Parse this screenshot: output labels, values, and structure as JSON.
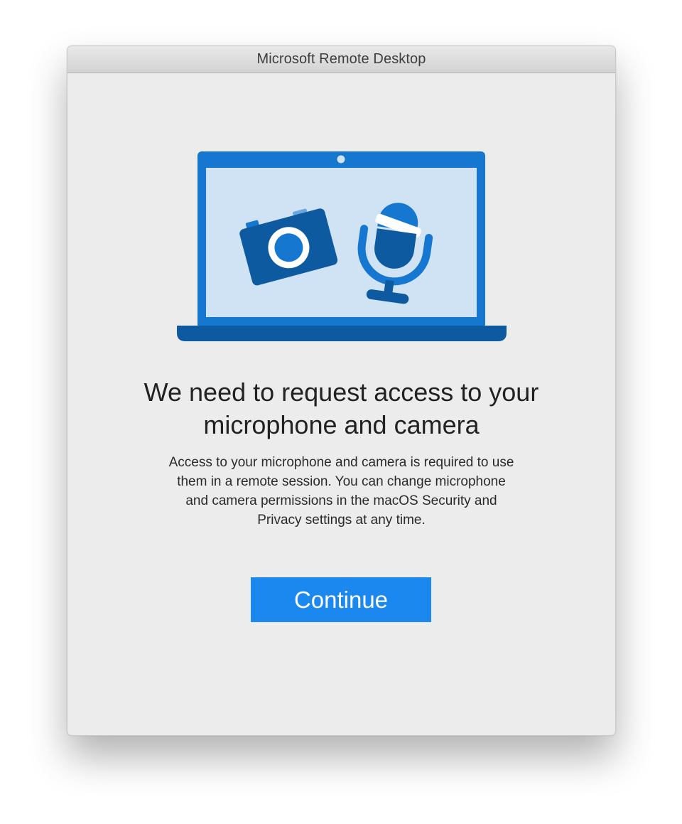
{
  "window": {
    "title": "Microsoft Remote Desktop"
  },
  "illustration": {
    "icons": [
      "laptop-icon",
      "camera-icon",
      "microphone-icon"
    ],
    "colors": {
      "laptop_frame": "#1577d0",
      "laptop_base": "#0d5aa1",
      "screen": "#cfe3f5",
      "camera": "#0d5aa1",
      "microphone": "#1577d0"
    }
  },
  "prompt": {
    "heading_line1": "We need to request access to your",
    "heading_line2": "microphone and camera",
    "body_line1": "Access to your microphone and camera is required to use",
    "body_line2": "them in a remote session. You can change microphone",
    "body_line3": "and camera permissions in the macOS Security and",
    "body_line4": "Privacy settings at any time."
  },
  "actions": {
    "continue_label": "Continue",
    "accent_color": "#1b88f0"
  }
}
